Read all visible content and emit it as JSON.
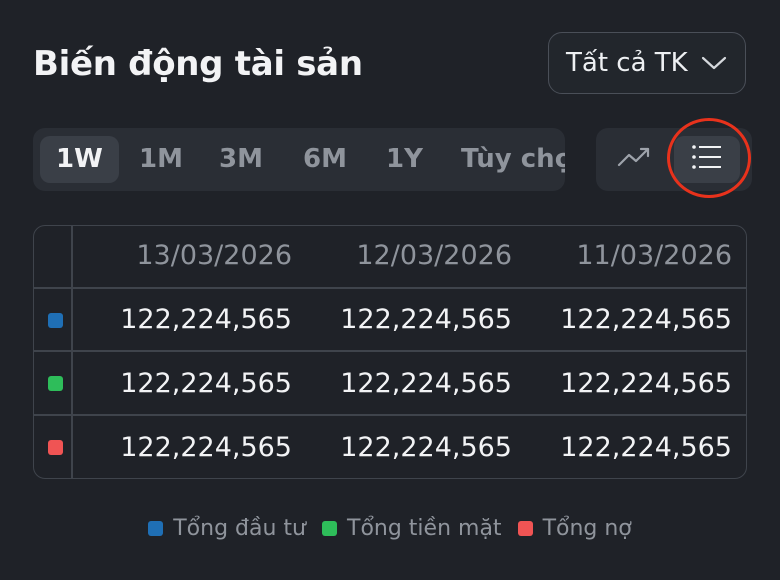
{
  "header": {
    "title": "Biến động tài sản",
    "account_select": "Tất cả TK"
  },
  "periods": [
    "1W",
    "1M",
    "3M",
    "6M",
    "1Y",
    "Tùy chọ"
  ],
  "active_period": "1W",
  "view_toggle": {
    "chart_icon": "trend-line-icon",
    "list_icon": "list-icon",
    "active": "list"
  },
  "table": {
    "dates": [
      "13/03/2026",
      "12/03/2026",
      "11/03/2026"
    ],
    "rows": [
      {
        "color": "#1f6fb5",
        "values": [
          "122,224,565",
          "122,224,565",
          "122,224,565"
        ]
      },
      {
        "color": "#2ebd5a",
        "values": [
          "122,224,565",
          "122,224,565",
          "122,224,565"
        ]
      },
      {
        "color": "#f05454",
        "values": [
          "122,224,565",
          "122,224,565",
          "122,224,565"
        ]
      }
    ]
  },
  "legend": [
    {
      "label": "Tổng đầu tư",
      "color": "#1f6fb5"
    },
    {
      "label": "Tổng tiền mặt",
      "color": "#2ebd5a"
    },
    {
      "label": "Tổng nợ",
      "color": "#f05454"
    }
  ]
}
